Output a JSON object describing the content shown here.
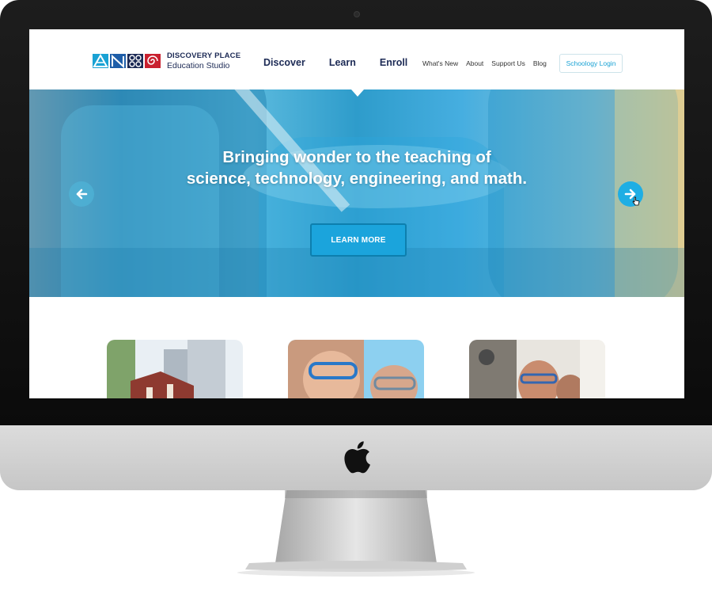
{
  "logo": {
    "line1": "DISCOVERY PLACE",
    "line2": "Education Studio"
  },
  "main_nav": [
    "Discover",
    "Learn",
    "Enroll"
  ],
  "sub_nav": [
    "What's New",
    "About",
    "Support Us",
    "Blog"
  ],
  "login_label": "Schoology Login",
  "hero": {
    "headline_line1": "Bringing wonder to the teaching of",
    "headline_line2": "science, technology, engineering, and math.",
    "cta_label": "LEARN MORE"
  },
  "colors": {
    "accent": "#1ba4dc",
    "navy": "#1c2a55",
    "logo_red": "#c9202f"
  },
  "icons": {
    "prev": "arrow-left-icon",
    "next": "arrow-right-icon",
    "cursor": "hand-cursor-icon",
    "brand": "apple-logo-icon"
  }
}
